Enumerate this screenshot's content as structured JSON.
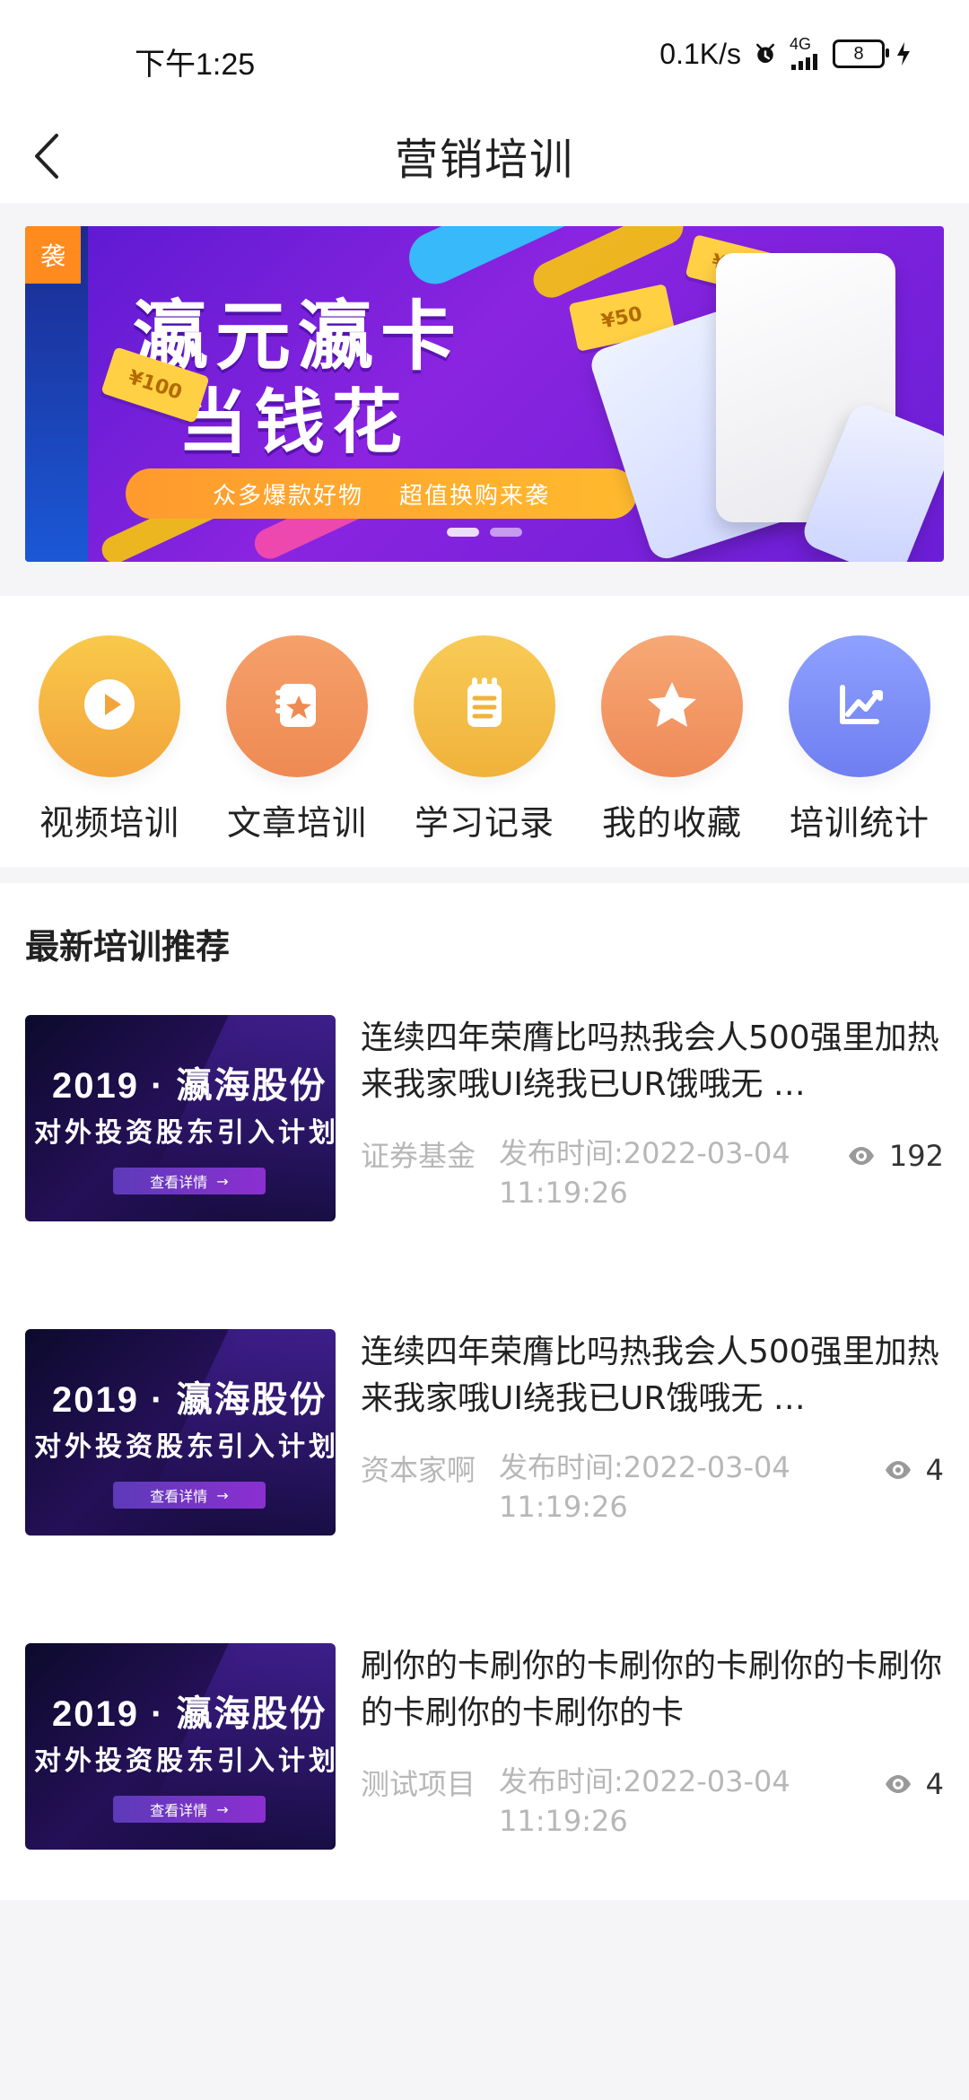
{
  "status_bar": {
    "time": "下午1:25",
    "network_speed": "0.1K/s",
    "network_type": "4G",
    "battery": "8",
    "icons": [
      "alarm-icon",
      "signal-icon",
      "battery-icon",
      "charging-icon"
    ]
  },
  "header": {
    "title": "营销培训",
    "back_icon": "chevron-left-icon"
  },
  "banner": {
    "tag": "袭",
    "title_line1": "瀛元瀛卡",
    "title_line2": "当钱花",
    "pill_left": "众多爆款好物",
    "pill_right": "超值换购来袭",
    "coupon_1": "¥100",
    "coupon_2": "¥50",
    "coupon_3": "¥20",
    "dots": 2,
    "active_dot": 1
  },
  "nav": [
    {
      "label": "视频培训",
      "icon": "play-icon",
      "color_from": "#f9c94a",
      "color_to": "#f2a43c"
    },
    {
      "label": "文章培训",
      "icon": "star-book-icon",
      "color_from": "#f6a06a",
      "color_to": "#ee8a53"
    },
    {
      "label": "学习记录",
      "icon": "notepad-icon",
      "color_from": "#f8cb56",
      "color_to": "#f0b23b"
    },
    {
      "label": "我的收藏",
      "icon": "star-icon",
      "color_from": "#f7a875",
      "color_to": "#ee8a57"
    },
    {
      "label": "培训统计",
      "icon": "chart-icon",
      "color_from": "#8ea1ff",
      "color_to": "#6f7ef0"
    }
  ],
  "recommend": {
    "title": "最新培训推荐",
    "items": [
      {
        "title": "连续四年荣膺比吗热我会人500强里加热来我家哦UI绕我已UR饿哦无 …",
        "category": "证券基金",
        "time_line1": "发布时间:2022-03-04",
        "time_line2": "11:19:26",
        "views": "192",
        "thumb_line1": "2019 · 瀛海股份",
        "thumb_line2": "对外投资股东引入计划",
        "thumb_button": "查看详情"
      },
      {
        "title": "连续四年荣膺比吗热我会人500强里加热来我家哦UI绕我已UR饿哦无 …",
        "category": "资本家啊",
        "time_line1": "发布时间:2022-03-04",
        "time_line2": "11:19:26",
        "views": "4",
        "thumb_line1": "2019 · 瀛海股份",
        "thumb_line2": "对外投资股东引入计划",
        "thumb_button": "查看详情"
      },
      {
        "title": "刷你的卡刷你的卡刷你的卡刷你的卡刷你的卡刷你的卡刷你的卡",
        "category": "测试项目",
        "time_line1": "发布时间:2022-03-04",
        "time_line2": "11:19:26",
        "views": "4",
        "thumb_line1": "2019 · 瀛海股份",
        "thumb_line2": "对外投资股东引入计划",
        "thumb_button": "查看详情"
      }
    ]
  }
}
